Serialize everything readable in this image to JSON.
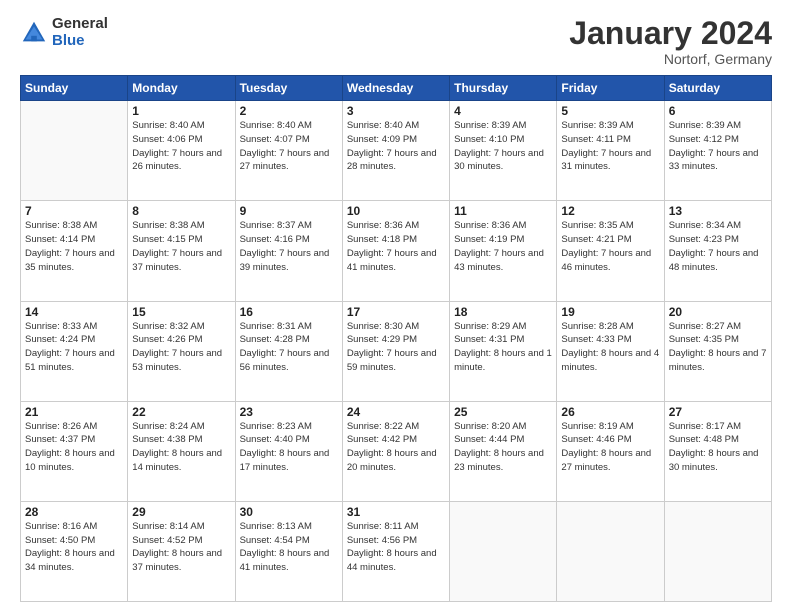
{
  "logo": {
    "general": "General",
    "blue": "Blue"
  },
  "header": {
    "month": "January 2024",
    "location": "Nortorf, Germany"
  },
  "weekdays": [
    "Sunday",
    "Monday",
    "Tuesday",
    "Wednesday",
    "Thursday",
    "Friday",
    "Saturday"
  ],
  "weeks": [
    [
      {
        "day": "",
        "sunrise": "",
        "sunset": "",
        "daylight": ""
      },
      {
        "day": "1",
        "sunrise": "Sunrise: 8:40 AM",
        "sunset": "Sunset: 4:06 PM",
        "daylight": "Daylight: 7 hours and 26 minutes."
      },
      {
        "day": "2",
        "sunrise": "Sunrise: 8:40 AM",
        "sunset": "Sunset: 4:07 PM",
        "daylight": "Daylight: 7 hours and 27 minutes."
      },
      {
        "day": "3",
        "sunrise": "Sunrise: 8:40 AM",
        "sunset": "Sunset: 4:09 PM",
        "daylight": "Daylight: 7 hours and 28 minutes."
      },
      {
        "day": "4",
        "sunrise": "Sunrise: 8:39 AM",
        "sunset": "Sunset: 4:10 PM",
        "daylight": "Daylight: 7 hours and 30 minutes."
      },
      {
        "day": "5",
        "sunrise": "Sunrise: 8:39 AM",
        "sunset": "Sunset: 4:11 PM",
        "daylight": "Daylight: 7 hours and 31 minutes."
      },
      {
        "day": "6",
        "sunrise": "Sunrise: 8:39 AM",
        "sunset": "Sunset: 4:12 PM",
        "daylight": "Daylight: 7 hours and 33 minutes."
      }
    ],
    [
      {
        "day": "7",
        "sunrise": "Sunrise: 8:38 AM",
        "sunset": "Sunset: 4:14 PM",
        "daylight": "Daylight: 7 hours and 35 minutes."
      },
      {
        "day": "8",
        "sunrise": "Sunrise: 8:38 AM",
        "sunset": "Sunset: 4:15 PM",
        "daylight": "Daylight: 7 hours and 37 minutes."
      },
      {
        "day": "9",
        "sunrise": "Sunrise: 8:37 AM",
        "sunset": "Sunset: 4:16 PM",
        "daylight": "Daylight: 7 hours and 39 minutes."
      },
      {
        "day": "10",
        "sunrise": "Sunrise: 8:36 AM",
        "sunset": "Sunset: 4:18 PM",
        "daylight": "Daylight: 7 hours and 41 minutes."
      },
      {
        "day": "11",
        "sunrise": "Sunrise: 8:36 AM",
        "sunset": "Sunset: 4:19 PM",
        "daylight": "Daylight: 7 hours and 43 minutes."
      },
      {
        "day": "12",
        "sunrise": "Sunrise: 8:35 AM",
        "sunset": "Sunset: 4:21 PM",
        "daylight": "Daylight: 7 hours and 46 minutes."
      },
      {
        "day": "13",
        "sunrise": "Sunrise: 8:34 AM",
        "sunset": "Sunset: 4:23 PM",
        "daylight": "Daylight: 7 hours and 48 minutes."
      }
    ],
    [
      {
        "day": "14",
        "sunrise": "Sunrise: 8:33 AM",
        "sunset": "Sunset: 4:24 PM",
        "daylight": "Daylight: 7 hours and 51 minutes."
      },
      {
        "day": "15",
        "sunrise": "Sunrise: 8:32 AM",
        "sunset": "Sunset: 4:26 PM",
        "daylight": "Daylight: 7 hours and 53 minutes."
      },
      {
        "day": "16",
        "sunrise": "Sunrise: 8:31 AM",
        "sunset": "Sunset: 4:28 PM",
        "daylight": "Daylight: 7 hours and 56 minutes."
      },
      {
        "day": "17",
        "sunrise": "Sunrise: 8:30 AM",
        "sunset": "Sunset: 4:29 PM",
        "daylight": "Daylight: 7 hours and 59 minutes."
      },
      {
        "day": "18",
        "sunrise": "Sunrise: 8:29 AM",
        "sunset": "Sunset: 4:31 PM",
        "daylight": "Daylight: 8 hours and 1 minute."
      },
      {
        "day": "19",
        "sunrise": "Sunrise: 8:28 AM",
        "sunset": "Sunset: 4:33 PM",
        "daylight": "Daylight: 8 hours and 4 minutes."
      },
      {
        "day": "20",
        "sunrise": "Sunrise: 8:27 AM",
        "sunset": "Sunset: 4:35 PM",
        "daylight": "Daylight: 8 hours and 7 minutes."
      }
    ],
    [
      {
        "day": "21",
        "sunrise": "Sunrise: 8:26 AM",
        "sunset": "Sunset: 4:37 PM",
        "daylight": "Daylight: 8 hours and 10 minutes."
      },
      {
        "day": "22",
        "sunrise": "Sunrise: 8:24 AM",
        "sunset": "Sunset: 4:38 PM",
        "daylight": "Daylight: 8 hours and 14 minutes."
      },
      {
        "day": "23",
        "sunrise": "Sunrise: 8:23 AM",
        "sunset": "Sunset: 4:40 PM",
        "daylight": "Daylight: 8 hours and 17 minutes."
      },
      {
        "day": "24",
        "sunrise": "Sunrise: 8:22 AM",
        "sunset": "Sunset: 4:42 PM",
        "daylight": "Daylight: 8 hours and 20 minutes."
      },
      {
        "day": "25",
        "sunrise": "Sunrise: 8:20 AM",
        "sunset": "Sunset: 4:44 PM",
        "daylight": "Daylight: 8 hours and 23 minutes."
      },
      {
        "day": "26",
        "sunrise": "Sunrise: 8:19 AM",
        "sunset": "Sunset: 4:46 PM",
        "daylight": "Daylight: 8 hours and 27 minutes."
      },
      {
        "day": "27",
        "sunrise": "Sunrise: 8:17 AM",
        "sunset": "Sunset: 4:48 PM",
        "daylight": "Daylight: 8 hours and 30 minutes."
      }
    ],
    [
      {
        "day": "28",
        "sunrise": "Sunrise: 8:16 AM",
        "sunset": "Sunset: 4:50 PM",
        "daylight": "Daylight: 8 hours and 34 minutes."
      },
      {
        "day": "29",
        "sunrise": "Sunrise: 8:14 AM",
        "sunset": "Sunset: 4:52 PM",
        "daylight": "Daylight: 8 hours and 37 minutes."
      },
      {
        "day": "30",
        "sunrise": "Sunrise: 8:13 AM",
        "sunset": "Sunset: 4:54 PM",
        "daylight": "Daylight: 8 hours and 41 minutes."
      },
      {
        "day": "31",
        "sunrise": "Sunrise: 8:11 AM",
        "sunset": "Sunset: 4:56 PM",
        "daylight": "Daylight: 8 hours and 44 minutes."
      },
      {
        "day": "",
        "sunrise": "",
        "sunset": "",
        "daylight": ""
      },
      {
        "day": "",
        "sunrise": "",
        "sunset": "",
        "daylight": ""
      },
      {
        "day": "",
        "sunrise": "",
        "sunset": "",
        "daylight": ""
      }
    ]
  ]
}
